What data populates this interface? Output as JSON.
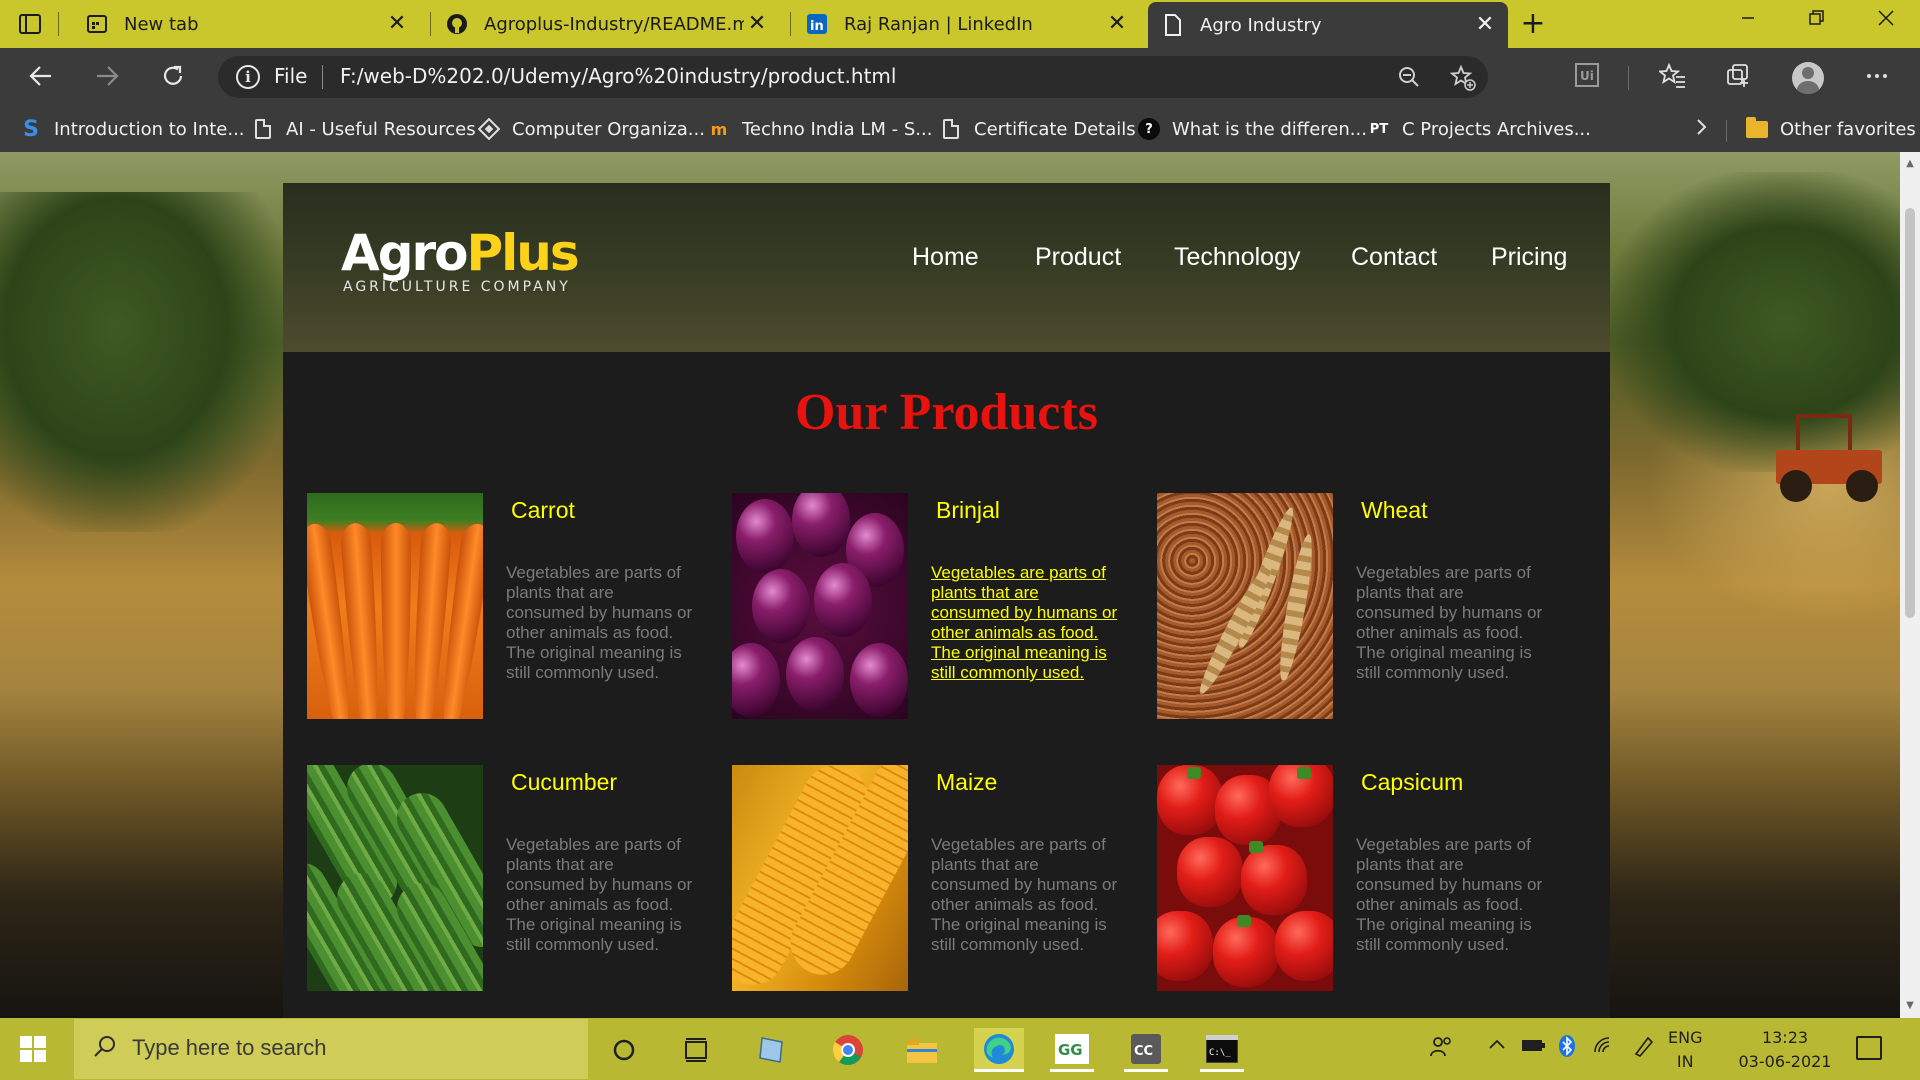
{
  "browser": {
    "tabs": [
      {
        "title": "New tab",
        "icon": "new-tab-page-icon",
        "active": false
      },
      {
        "title": "Agroplus-Industry/README.md at",
        "icon": "github-icon",
        "active": false
      },
      {
        "title": "Raj Ranjan | LinkedIn",
        "icon": "linkedin-icon",
        "active": false
      },
      {
        "title": "Agro Industry",
        "icon": "page-icon",
        "active": true
      }
    ],
    "close_glyph": "✕",
    "new_tab_glyph": "+",
    "address": {
      "scheme_label": "File",
      "url": "F:/web-D%202.0/Udemy/Agro%20industry/product.html"
    },
    "favorites": [
      {
        "label": "Introduction to Inte...",
        "icon": "s-logo-icon"
      },
      {
        "label": "AI - Useful Resources",
        "icon": "page-icon"
      },
      {
        "label": "Computer Organiza...",
        "icon": "diamond-logo-icon"
      },
      {
        "label": "Techno India LM - S...",
        "icon": "moodle-icon"
      },
      {
        "label": "Certificate Details",
        "icon": "page-icon"
      },
      {
        "label": "What is the differen...",
        "icon": "question-icon"
      },
      {
        "label": "C Projects Archives...",
        "icon": "pt-logo-icon"
      }
    ],
    "other_favorites": "Other favorites"
  },
  "site": {
    "logo": {
      "agro": "Agro",
      "plus": "Plus",
      "tagline": "AGRICULTURE COMPANY"
    },
    "nav": [
      "Home",
      "Product",
      "Technology",
      "Contact",
      "Pricing"
    ],
    "heading": "Our Products",
    "products": [
      {
        "name": "Carrot",
        "desc": "Vegetables are parts of plants that are consumed by humans or other animals as food. The original meaning is still commonly used.",
        "hovered": false
      },
      {
        "name": "Brinjal",
        "desc": "Vegetables are parts of plants that are consumed by humans or other animals as food. The original meaning is still commonly used.",
        "hovered": true
      },
      {
        "name": "Wheat",
        "desc": "Vegetables are parts of plants that are consumed by humans or other animals as food. The original meaning is still commonly used.",
        "hovered": false
      },
      {
        "name": "Cucumber",
        "desc": "Vegetables are parts of plants that are consumed by humans or other animals as food. The original meaning is still commonly used.",
        "hovered": false
      },
      {
        "name": "Maize",
        "desc": "Vegetables are parts of plants that are consumed by humans or other animals as food. The original meaning is still commonly used.",
        "hovered": false
      },
      {
        "name": "Capsicum",
        "desc": "Vegetables are parts of plants that are consumed by humans or other animals as food. The original meaning is still commonly used.",
        "hovered": false
      }
    ]
  },
  "taskbar": {
    "search_placeholder": "Type here to search",
    "language": "ENG",
    "region": "IN",
    "time": "13:23",
    "date": "03-06-2021"
  },
  "colors": {
    "tabbar": "#c9c72c",
    "chrome": "#3b3b3b",
    "heading": "#e8120f",
    "product_name": "#ffff00",
    "product_desc": "#7b7b7b",
    "taskbar": "#b9b832"
  }
}
